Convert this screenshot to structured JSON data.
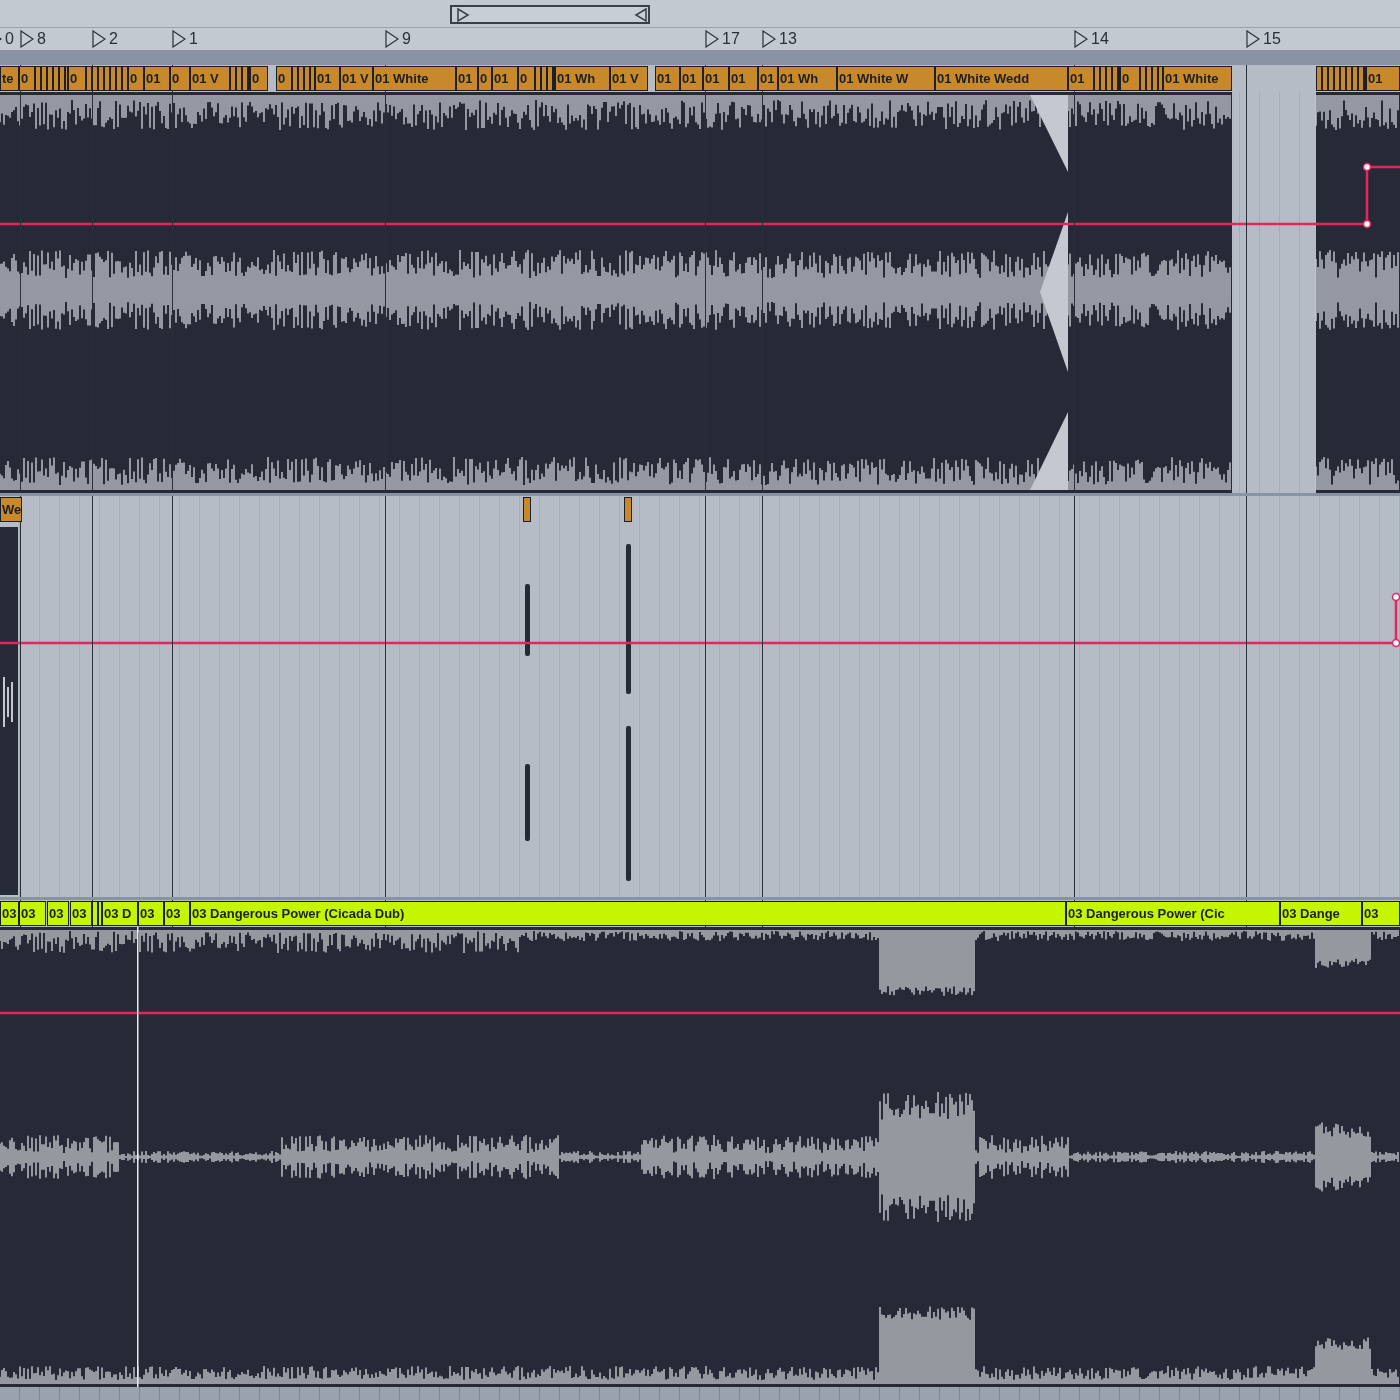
{
  "locators": [
    {
      "label": "0"
    },
    {
      "label": "8"
    },
    {
      "label": "2"
    },
    {
      "label": "1"
    },
    {
      "label": "9"
    },
    {
      "label": "17"
    },
    {
      "label": "13"
    },
    {
      "label": "14"
    },
    {
      "label": "15"
    }
  ],
  "tracks": [
    {
      "color": "#c8892a",
      "clips": [
        {
          "kind": "clip",
          "label": "te"
        },
        {
          "kind": "clip",
          "label": "0"
        },
        {
          "kind": "stripes"
        },
        {
          "kind": "clip",
          "label": "0"
        },
        {
          "kind": "stripes"
        },
        {
          "kind": "clip",
          "label": "0"
        },
        {
          "kind": "clip",
          "label": "01"
        },
        {
          "kind": "clip",
          "label": "0"
        },
        {
          "kind": "clip",
          "label": "01 V"
        },
        {
          "kind": "stripes"
        },
        {
          "kind": "clip",
          "label": "0"
        },
        {
          "kind": "clip",
          "label": "0"
        },
        {
          "kind": "stripes"
        },
        {
          "kind": "clip",
          "label": "01"
        },
        {
          "kind": "clip",
          "label": "01 V"
        },
        {
          "kind": "clip",
          "label": "01 White"
        },
        {
          "kind": "clip",
          "label": "01"
        },
        {
          "kind": "clip",
          "label": "0"
        },
        {
          "kind": "clip",
          "label": "01"
        },
        {
          "kind": "clip",
          "label": "0"
        },
        {
          "kind": "stripes"
        },
        {
          "kind": "clip",
          "label": "01 Wh"
        },
        {
          "kind": "clip",
          "label": "01 V"
        },
        {
          "kind": "clip",
          "label": "01"
        },
        {
          "kind": "clip",
          "label": "01"
        },
        {
          "kind": "clip",
          "label": "01"
        },
        {
          "kind": "clip",
          "label": "01"
        },
        {
          "kind": "clip",
          "label": "01"
        },
        {
          "kind": "clip",
          "label": "01 Wh"
        },
        {
          "kind": "clip",
          "label": "01 White W"
        },
        {
          "kind": "clip",
          "label": "01 White Wedd"
        },
        {
          "kind": "clip",
          "label": "01"
        },
        {
          "kind": "stripes"
        },
        {
          "kind": "clip",
          "label": "0"
        },
        {
          "kind": "stripes"
        },
        {
          "kind": "clip",
          "label": "01 White"
        },
        {
          "kind": "stripes"
        },
        {
          "kind": "clip",
          "label": "01"
        }
      ]
    },
    {
      "color": "#c8892a",
      "clips": [
        {
          "kind": "clip",
          "label": "We"
        },
        {
          "kind": "blank"
        },
        {
          "kind": "blank"
        }
      ]
    },
    {
      "color": "#c6f500",
      "clips": [
        {
          "kind": "clip",
          "label": "03"
        },
        {
          "kind": "clip",
          "label": "03"
        },
        {
          "kind": "clip",
          "label": "03"
        },
        {
          "kind": "clip",
          "label": "03"
        },
        {
          "kind": "stripes"
        },
        {
          "kind": "clip",
          "label": "03 D"
        },
        {
          "kind": "clip",
          "label": "03"
        },
        {
          "kind": "clip",
          "label": "03"
        },
        {
          "kind": "clip",
          "label": "03 Dangerous Power (Cicada Dub)"
        },
        {
          "kind": "clip",
          "label": "03 Dangerous Power (Cic"
        },
        {
          "kind": "clip",
          "label": "03 Dange"
        },
        {
          "kind": "clip",
          "label": "03"
        }
      ]
    }
  ]
}
